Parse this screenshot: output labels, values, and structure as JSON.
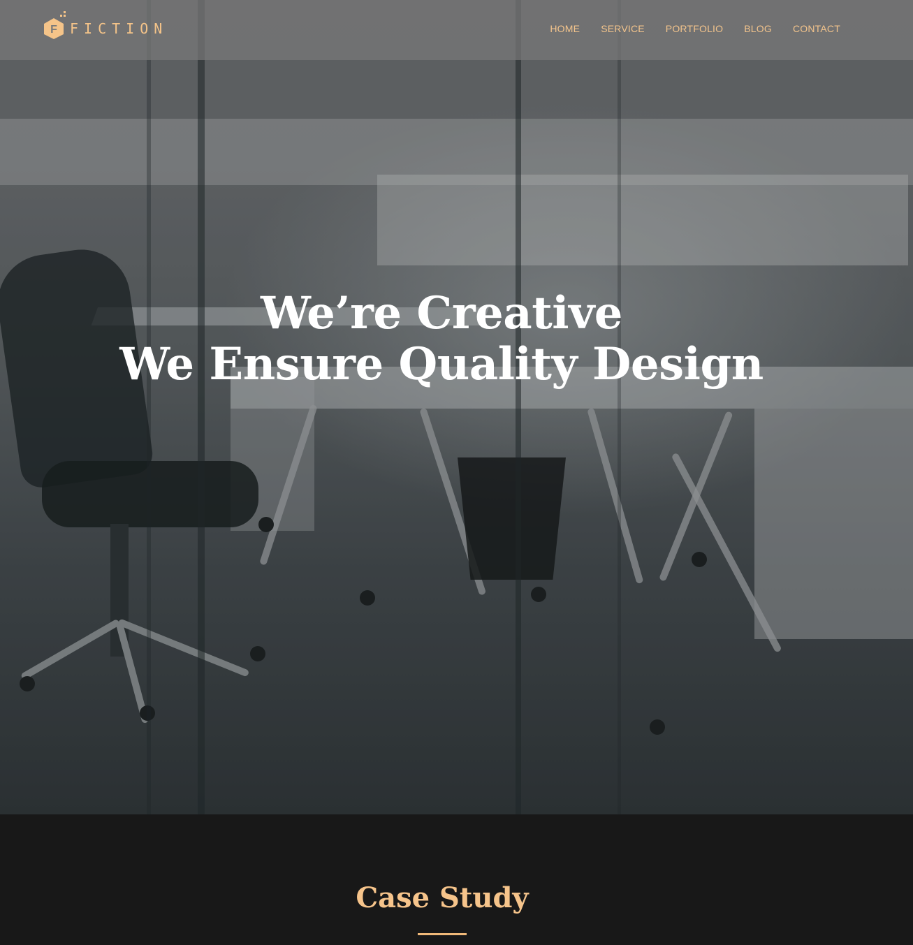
{
  "brand": {
    "name": "FICTION",
    "logo_letter": "F",
    "accent_color": "#f5c489"
  },
  "nav": {
    "items": [
      {
        "label": "HOME"
      },
      {
        "label": "SERVICE"
      },
      {
        "label": "PORTFOLIO"
      },
      {
        "label": "BLOG"
      },
      {
        "label": "CONTACT"
      }
    ]
  },
  "hero": {
    "line1": "We’re Creative",
    "line2": "We Ensure Quality Design"
  },
  "case_study": {
    "title": "Case Study"
  }
}
